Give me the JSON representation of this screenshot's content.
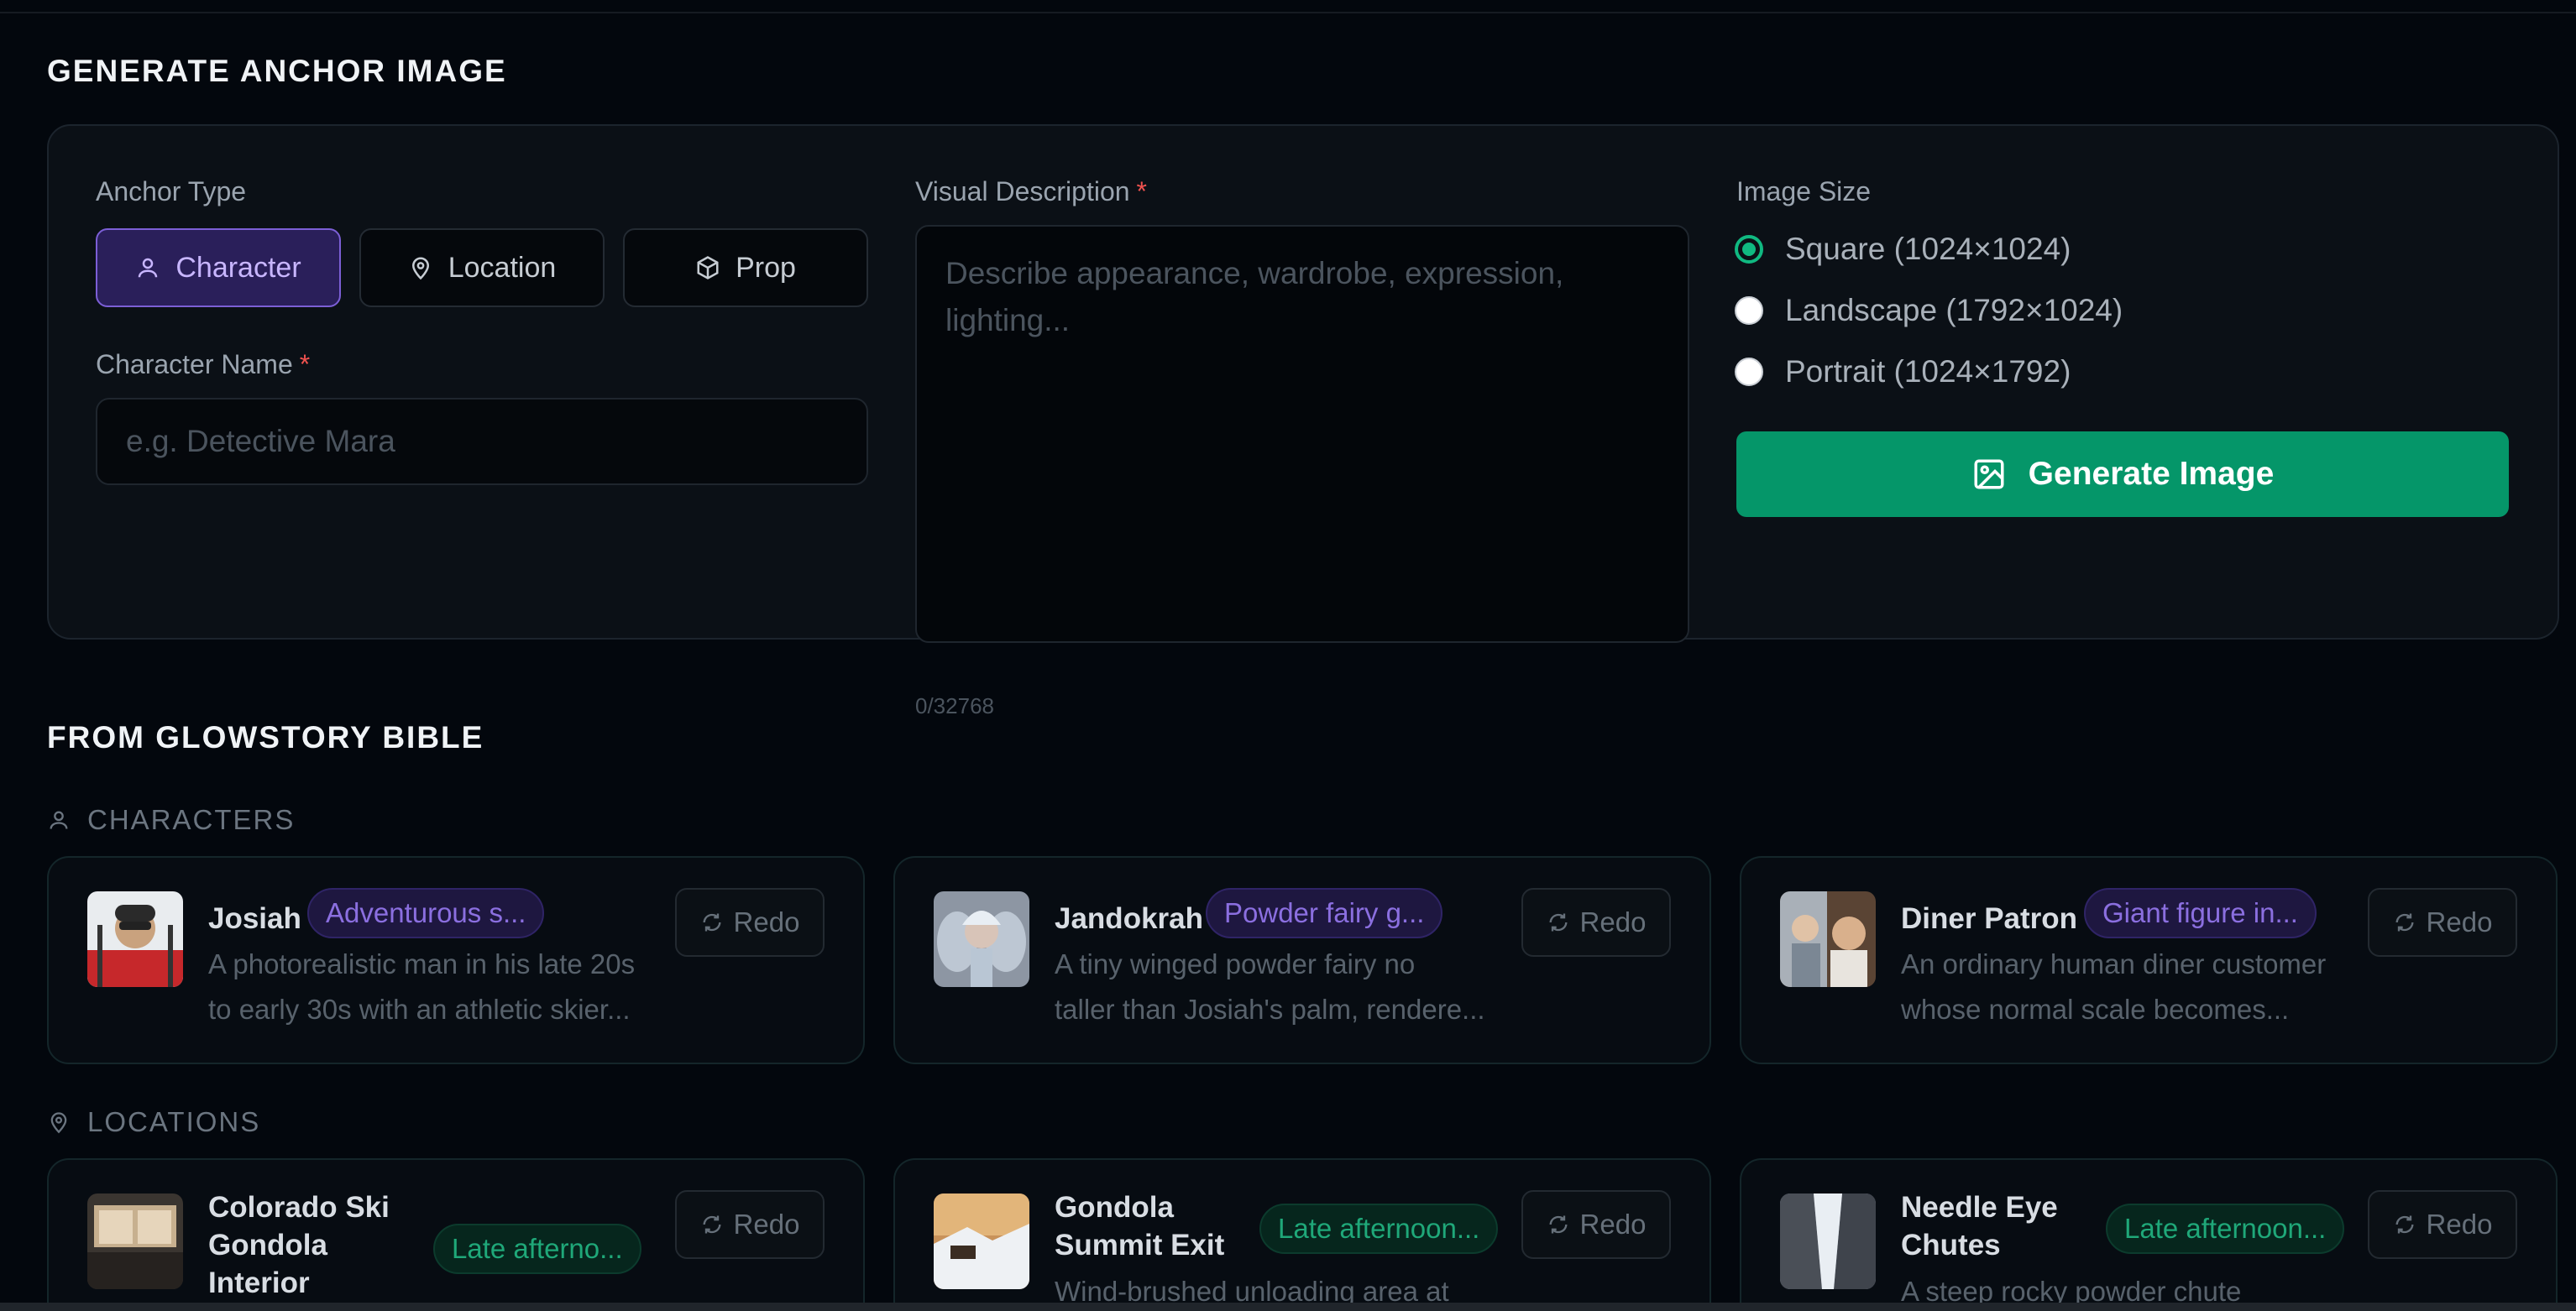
{
  "generate": {
    "title": "GENERATE ANCHOR IMAGE",
    "anchor_type_label": "Anchor Type",
    "types": [
      "Character",
      "Location",
      "Prop"
    ],
    "active_type": "Character",
    "name_label": "Character Name",
    "name_placeholder": "e.g. Detective Mara",
    "required_mark": "*",
    "desc_label": "Visual Description",
    "desc_placeholder": "Describe appearance, wardrobe, expression, lighting...",
    "counter": "0/32768",
    "size_label": "Image Size",
    "sizes": [
      "Square (1024×1024)",
      "Landscape (1792×1024)",
      "Portrait (1024×1792)"
    ],
    "selected_size": "Square (1024×1024)",
    "generate_button": "Generate Image"
  },
  "bible": {
    "title": "FROM GLOWSTORY BIBLE",
    "characters_label": "CHARACTERS",
    "locations_label": "LOCATIONS",
    "redo_label": "Redo",
    "characters": [
      {
        "name": "Josiah",
        "badge": "Adventurous s...",
        "desc1": "A photorealistic man in his late 20s",
        "desc2": "to early 30s with an athletic skier..."
      },
      {
        "name": "Jandokrah",
        "badge": "Powder fairy g...",
        "desc1": "A tiny winged powder fairy no",
        "desc2": "taller than Josiah's palm, rendere..."
      },
      {
        "name": "Diner Patron",
        "badge": "Giant figure in...",
        "desc1": "An ordinary human diner customer",
        "desc2": "whose normal scale becomes..."
      }
    ],
    "locations": [
      {
        "name1": "Colorado Ski",
        "name2": "Gondola",
        "name3": "Interior",
        "badge": "Late afterno...",
        "desc1": ""
      },
      {
        "name1": "Gondola",
        "name2": "Summit Exit",
        "name3": "",
        "badge": "Late afternoon...",
        "desc1": "Wind-brushed unloading area at"
      },
      {
        "name1": "Needle Eye",
        "name2": "Chutes",
        "name3": "",
        "badge": "Late afternoon...",
        "desc1": "A steep rocky powder chute"
      }
    ]
  },
  "colors": {
    "accent_purple": "#7c5fd6",
    "accent_green": "#059669",
    "background": "#03070d"
  },
  "icons": {
    "character": "person-icon",
    "location": "map-pin-icon",
    "prop": "box-icon",
    "generate": "image-icon",
    "redo": "refresh-icon"
  }
}
